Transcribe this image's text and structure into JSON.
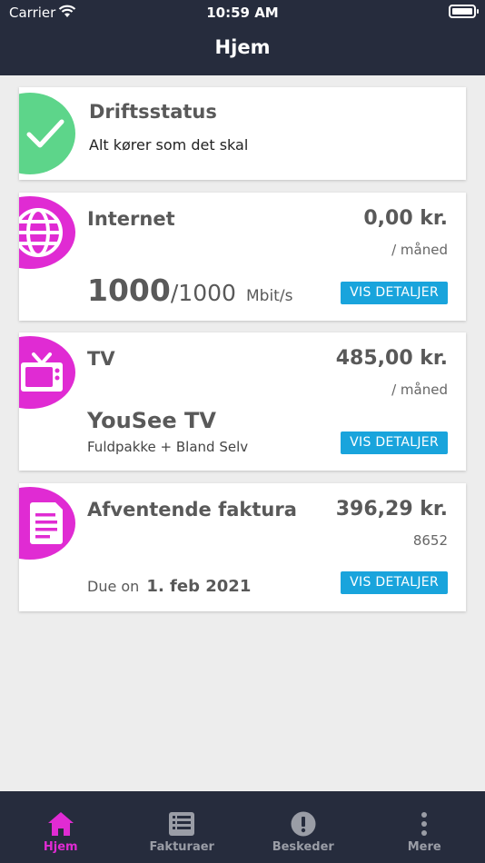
{
  "status_bar": {
    "carrier": "Carrier",
    "time": "10:59 AM"
  },
  "header": {
    "title": "Hjem"
  },
  "colors": {
    "accent": "#e02bd3",
    "success": "#5dd58a",
    "button": "#19a4dc",
    "navbar": "#262c3d"
  },
  "driftsstatus": {
    "title": "Driftsstatus",
    "message": "Alt kører som det skal",
    "icon": "check-icon"
  },
  "internet": {
    "title": "Internet",
    "price": "0,00 kr.",
    "period": "/ måned",
    "speed_current": "1000",
    "speed_max": "/1000",
    "speed_unit": "Mbit/s",
    "button": "VIS DETALJER",
    "icon": "globe-icon"
  },
  "tv": {
    "title": "TV",
    "price": "485,00 kr.",
    "period": "/ måned",
    "package_name": "YouSee TV",
    "package_detail": "Fuldpakke + Bland Selv",
    "button": "VIS DETALJER",
    "icon": "tv-icon"
  },
  "invoice": {
    "title": "Afventende faktura",
    "price": "396,29 kr.",
    "number": "8652",
    "due_label": "Due on",
    "due_date": "1. feb 2021",
    "button": "VIS DETALJER",
    "icon": "document-icon"
  },
  "tabbar": {
    "items": [
      {
        "label": "Hjem",
        "icon": "home-icon",
        "active": true
      },
      {
        "label": "Fakturaer",
        "icon": "invoices-icon",
        "active": false
      },
      {
        "label": "Beskeder",
        "icon": "alert-icon",
        "active": false
      },
      {
        "label": "Mere",
        "icon": "more-icon",
        "active": false
      }
    ]
  }
}
